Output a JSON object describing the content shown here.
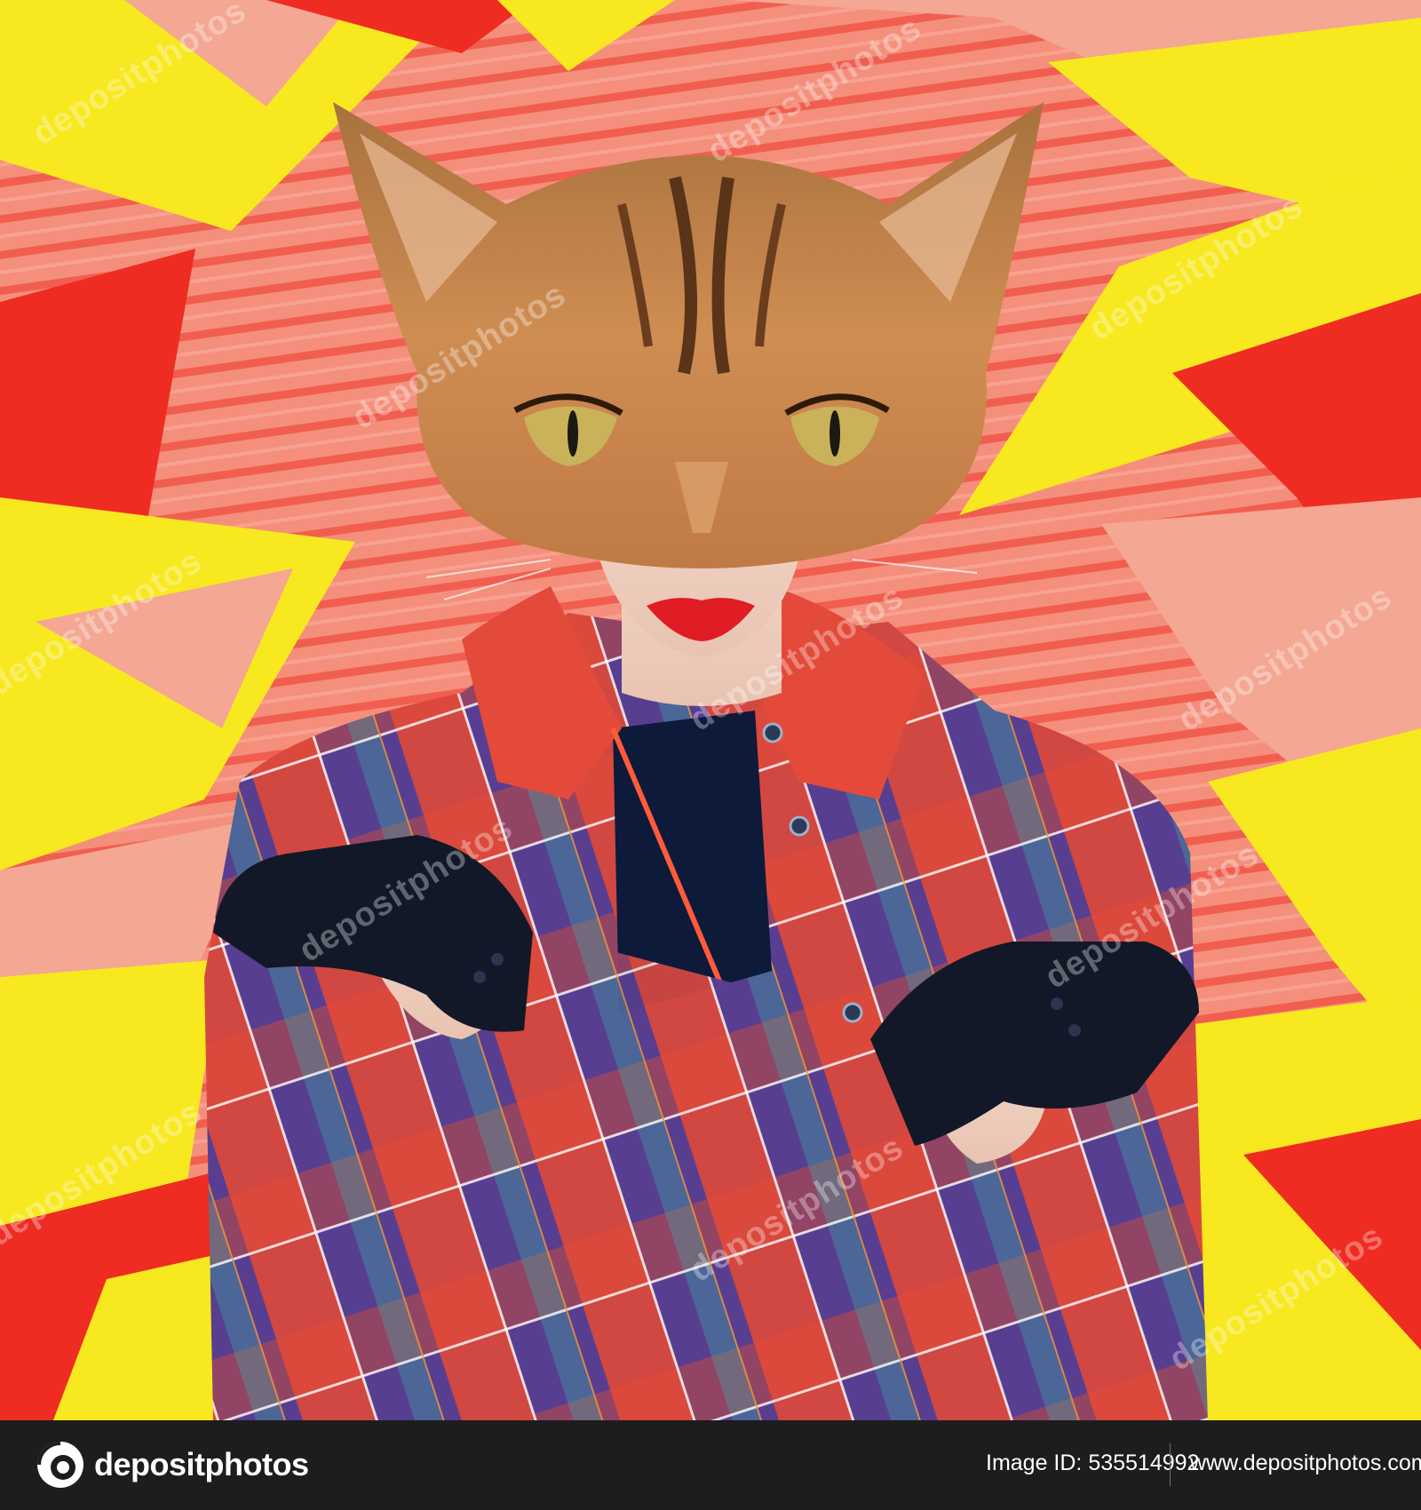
{
  "image": {
    "subject": "cat-head-woman-collage",
    "palette": {
      "background_red": "#ee2a22",
      "background_yellow": "#f8ea1e",
      "background_peach": "#f2a48e",
      "cat_fur": "#c9844a",
      "jacket_blue": "#2f3f9a",
      "jacket_red": "#e8473a",
      "glove": "#121827",
      "lips": "#e01c24"
    }
  },
  "watermark": {
    "text": "depositphotos"
  },
  "footer": {
    "brand_name": "depositphotos",
    "image_id_label": "Image ID:",
    "image_id_value": "535514992",
    "image_id_text": "Image ID: 535514992",
    "site_url": "www.depositphotos.com"
  }
}
